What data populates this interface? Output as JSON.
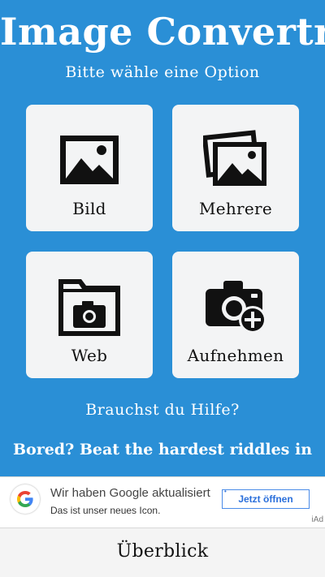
{
  "app": {
    "title": "Image Convertr",
    "subtitle": "Bitte wähle eine Option"
  },
  "options": [
    {
      "label": "Bild",
      "icon": "image-icon"
    },
    {
      "label": "Mehrere",
      "icon": "multiple-images-icon"
    },
    {
      "label": "Web",
      "icon": "folder-camera-icon"
    },
    {
      "label": "Aufnehmen",
      "icon": "camera-add-icon"
    }
  ],
  "help": {
    "label": "Brauchst du Hilfe?"
  },
  "promo": {
    "text": "Bored? Beat the hardest riddles in"
  },
  "ad": {
    "headline": "Wir haben Google aktualisiert",
    "body": "Das ist unser neues Icon.",
    "cta": "Jetzt öffnen",
    "badge": "iAd"
  },
  "bottom_bar": {
    "label": "Überblick"
  },
  "colors": {
    "background": "#2a8fd6",
    "tile": "#f3f4f5",
    "icon": "#111111",
    "ad_button": "#2a6fdb"
  }
}
